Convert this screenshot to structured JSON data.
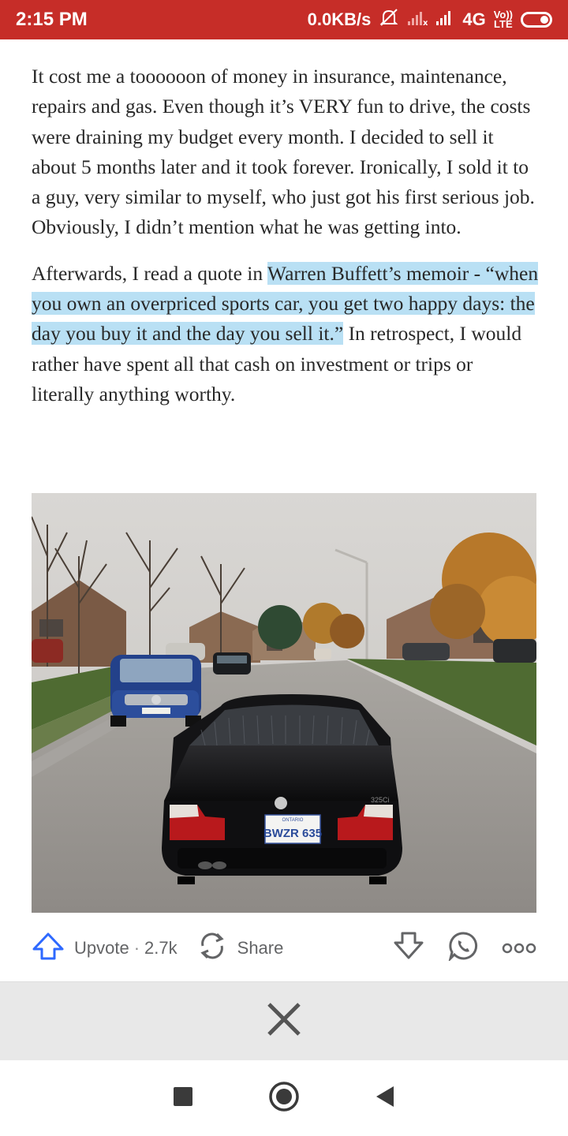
{
  "status_bar": {
    "time": "2:15 PM",
    "network_speed": "0.0KB/s",
    "network_type": "4G",
    "volte_top": "Vo))",
    "volte_bottom": "LTE",
    "icons": [
      "mute-icon",
      "signal-icon",
      "signal-icon",
      "battery-icon"
    ]
  },
  "article": {
    "paragraph1": "It cost me a toooooon of money in insurance, maintenance, repairs and gas. Even though it’s VERY fun to drive, the costs were draining my budget every month. I decided to sell it about 5 months later and it took forever. Ironically, I sold it to a guy, very similar to myself, who just got his first serious job. Obviously, I didn’t mention what he was getting into.",
    "paragraph2_before": "Afterwards, I read a quote in ",
    "paragraph2_highlight": "Warren Buffett’s memoir - “when you own an overpriced sports car, you get two happy days: the day you buy it and the day you sell it.”",
    "paragraph2_after": " In retrospect, I would rather have spent all that cash on investment or trips or literally anything worthy.",
    "highlight_color": "#b9e0f4",
    "photo": {
      "license_plate": "BWZR 635",
      "plate_region": "ONTARIO",
      "badge": "325Ci"
    }
  },
  "actions": {
    "upvote_label": "Upvote",
    "upvote_count": "2.7k",
    "separator": "·",
    "share_label": "Share",
    "icons": [
      "upvote-icon",
      "share-icon",
      "downvote-icon",
      "whatsapp-icon",
      "more-icon"
    ]
  },
  "nav_bar": {
    "icons": [
      "recents-icon",
      "home-icon",
      "back-icon"
    ]
  },
  "colors": {
    "status_bar": "#c62d28",
    "accent_blue": "#2e69ff",
    "text": "#282828",
    "secondary_text": "#636466"
  }
}
